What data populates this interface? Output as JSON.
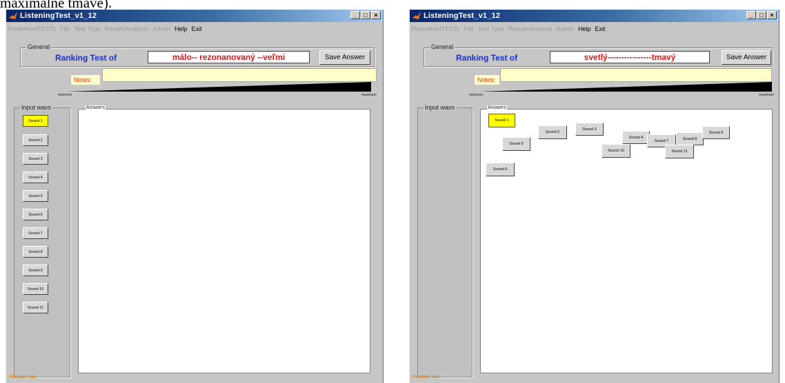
{
  "doc_fragment": "maximálne tmavé).",
  "windows": [
    {
      "title": "ListeningTest_v1_12",
      "window_buttons": [
        "_",
        "□",
        "×"
      ],
      "menu": [
        "PredefinedTESTs",
        "File",
        "Test Type",
        "ResultsAnalysis",
        "Admin",
        "Help",
        "Exit"
      ],
      "general_legend": "General",
      "ranking_label": "Ranking Test of",
      "ranking_value": "málo-- rezonanovaný --veľmi",
      "save_label": "Save Answer",
      "notes_label": "Notes:",
      "slider_min": "minimum",
      "slider_max": "maximum",
      "input_legend": "Input wavs",
      "answers_legend": "Answers",
      "sounds": [
        "Sound 1",
        "Sound 2",
        "Sound 3",
        "Sound 4",
        "Sound 5",
        "Sound 6",
        "Sound 7",
        "Sound 8",
        "Sound 9",
        "Sound 10",
        "Sound 11"
      ],
      "status": "Position: out"
    },
    {
      "title": "ListeningTest_v1_12",
      "window_buttons": [
        "_",
        "□",
        "×"
      ],
      "menu": [
        "PredefinedTESTs",
        "File",
        "Test Type",
        "ResultsAnalysis",
        "Admin",
        "Help",
        "Exit"
      ],
      "general_legend": "General",
      "ranking_label": "Ranking Test of",
      "ranking_value": "svetlý----------------tmavý",
      "save_label": "Save Answer",
      "notes_label": "Notes:",
      "slider_min": "minimum",
      "slider_max": "maximum",
      "input_legend": "Input wavs",
      "answers_legend": "Answers",
      "sounds": [
        "Sound 1",
        "Sound 2",
        "Sound 3",
        "Sound 4",
        "Sound 5",
        "Sound 6",
        "Sound 7",
        "Sound 8",
        "Sound 9",
        "Sound 10",
        "Sound 11"
      ],
      "status": "Position: out"
    }
  ],
  "colors": {
    "title_gradient_start": "#0a246a",
    "ranking_label": "#1a2fd0",
    "ranking_value": "#e01414",
    "selected_sound": "#ffff00",
    "status": "#e07800"
  }
}
